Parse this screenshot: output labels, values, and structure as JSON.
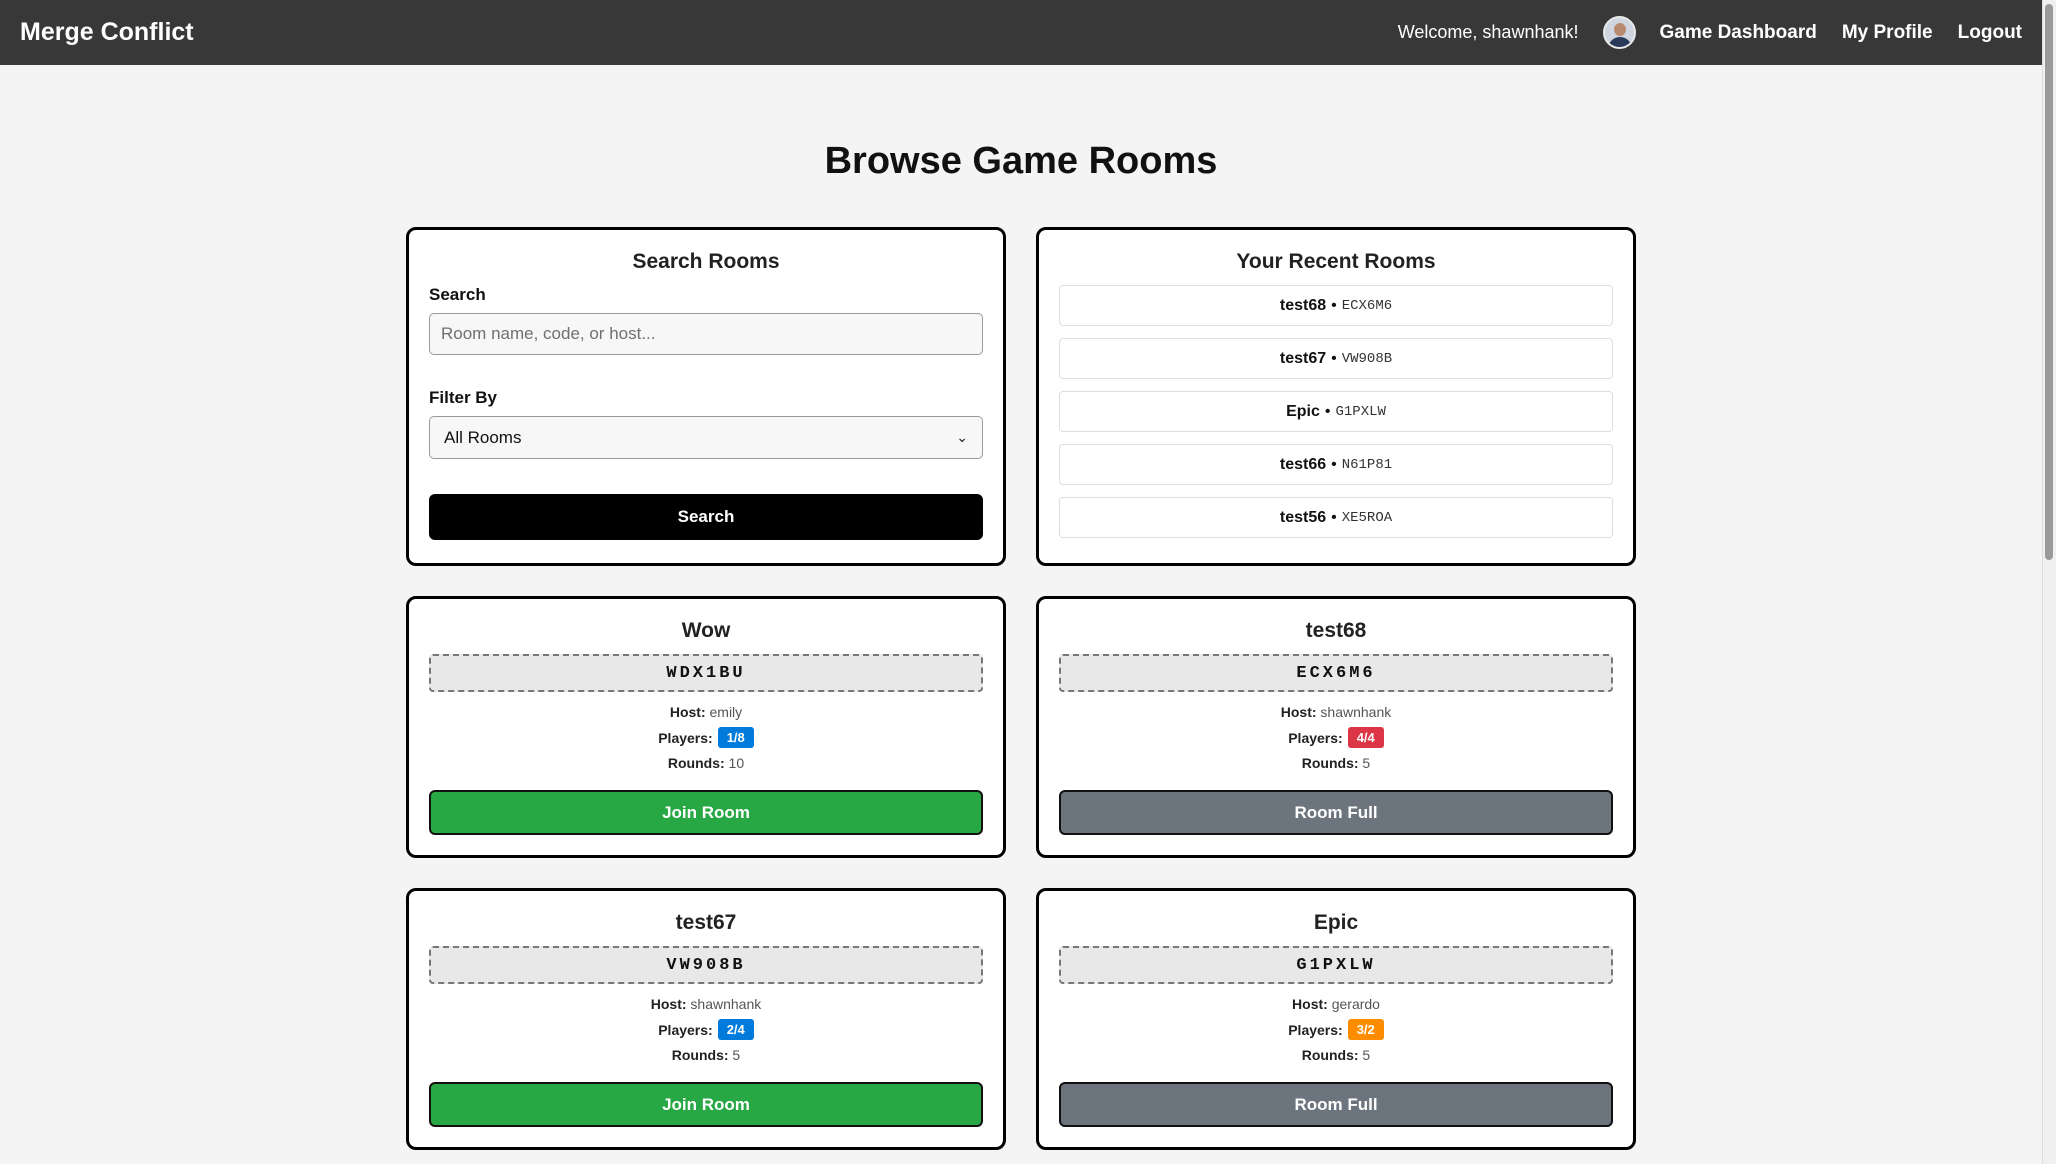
{
  "navbar": {
    "brand": "Merge Conflict",
    "welcome": "Welcome, shawnhank!",
    "links": [
      "Game Dashboard",
      "My Profile",
      "Logout"
    ]
  },
  "page": {
    "title": "Browse Game Rooms"
  },
  "search": {
    "title": "Search Rooms",
    "search_label": "Search",
    "placeholder": "Room name, code, or host...",
    "value": "",
    "filter_label": "Filter By",
    "filter_selected": "All Rooms",
    "button_label": "Search"
  },
  "recent": {
    "title": "Your Recent Rooms",
    "items": [
      {
        "name": "test68",
        "sep": "•",
        "code": "ECX6M6"
      },
      {
        "name": "test67",
        "sep": "•",
        "code": "VW908B"
      },
      {
        "name": "Epic",
        "sep": "•",
        "code": "G1PXLW"
      },
      {
        "name": "test66",
        "sep": "•",
        "code": "N61P81"
      },
      {
        "name": "test56",
        "sep": "•",
        "code": "XE5ROA"
      }
    ]
  },
  "labels": {
    "host": "Host:",
    "players": "Players:",
    "rounds": "Rounds:"
  },
  "colors": {
    "join": "#28a745",
    "full": "#6c757d",
    "badge_blue": "#007bdb",
    "badge_red": "#dc3545",
    "badge_orange": "#fd8c00"
  },
  "rooms": [
    {
      "name": "Wow",
      "code": "WDX1BU",
      "host": "emily",
      "players": "1/8",
      "badge_color": "#007bdb",
      "rounds": "10",
      "button": "Join Room",
      "status": "join"
    },
    {
      "name": "test68",
      "code": "ECX6M6",
      "host": "shawnhank",
      "players": "4/4",
      "badge_color": "#dc3545",
      "rounds": "5",
      "button": "Room Full",
      "status": "full"
    },
    {
      "name": "test67",
      "code": "VW908B",
      "host": "shawnhank",
      "players": "2/4",
      "badge_color": "#007bdb",
      "rounds": "5",
      "button": "Join Room",
      "status": "join"
    },
    {
      "name": "Epic",
      "code": "G1PXLW",
      "host": "gerardo",
      "players": "3/2",
      "badge_color": "#fd8c00",
      "rounds": "5",
      "button": "Room Full",
      "status": "full"
    }
  ]
}
